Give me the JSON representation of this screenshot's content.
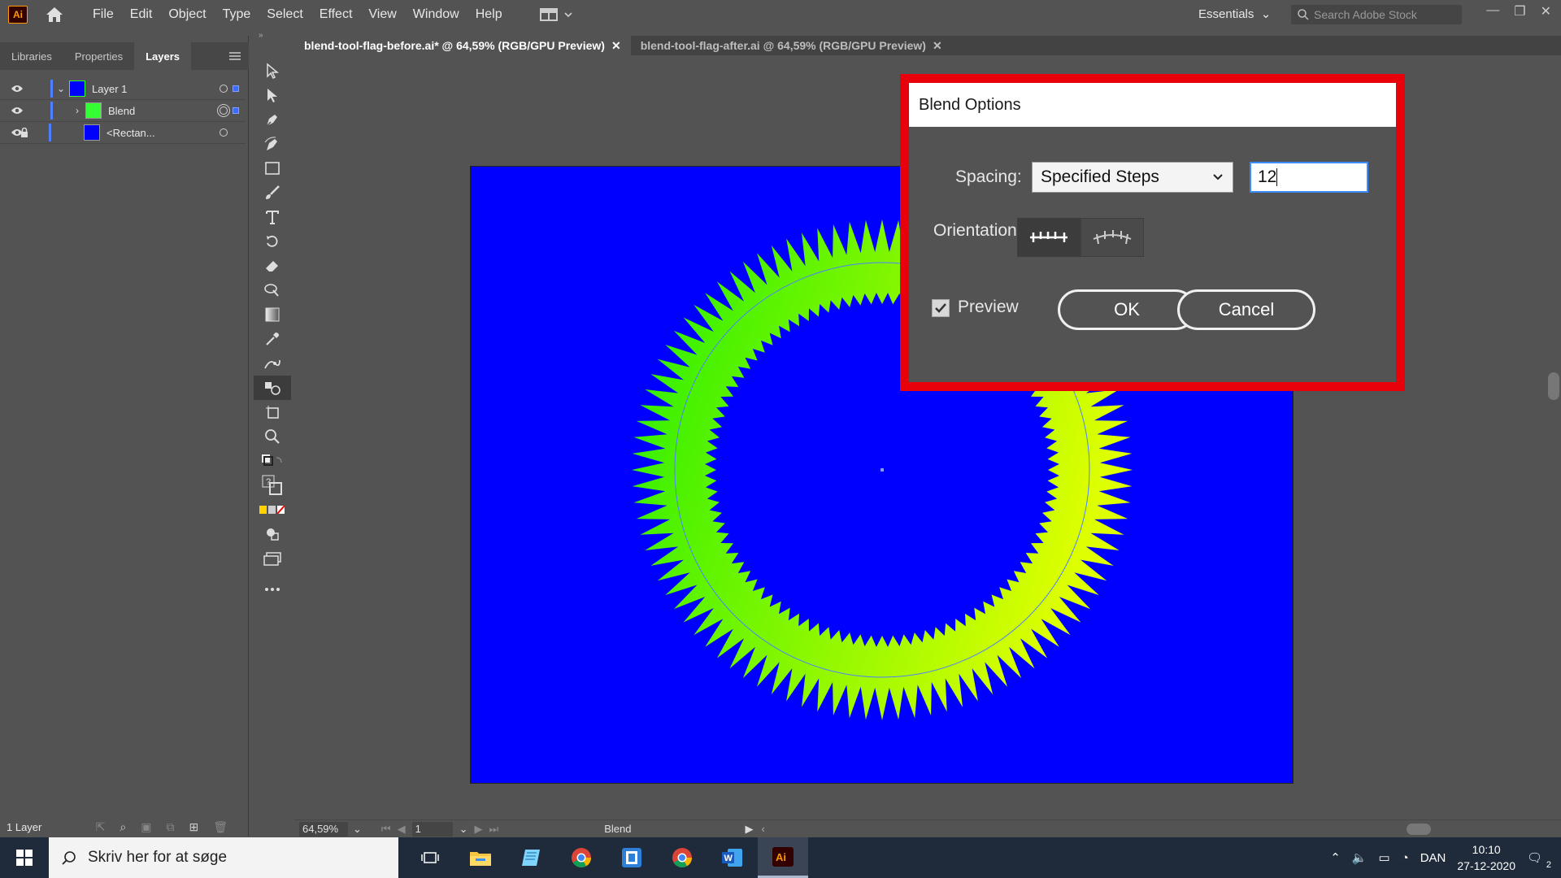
{
  "menubar": {
    "logo_text": "Ai",
    "menus": [
      "File",
      "Edit",
      "Object",
      "Type",
      "Select",
      "Effect",
      "View",
      "Window",
      "Help"
    ],
    "workspace": "Essentials",
    "stock_search_placeholder": "Search Adobe Stock"
  },
  "left_panel": {
    "tabs": [
      "Libraries",
      "Properties",
      "Layers"
    ],
    "active_tab": "Layers",
    "layers": [
      {
        "name": "Layer 1",
        "thumb_color": "#0000ff"
      },
      {
        "name": "Blend",
        "thumb_color": "#33ff33"
      },
      {
        "name": "<Rectan...",
        "thumb_color": "#0000ff"
      }
    ],
    "footer_label": "1 Layer"
  },
  "doc_tabs": [
    {
      "label": "blend-tool-flag-before.ai* @ 64,59% (RGB/GPU Preview)",
      "close": "✕"
    },
    {
      "label": "blend-tool-flag-after.ai @ 64,59% (RGB/GPU Preview)",
      "close": "✕"
    }
  ],
  "status_bar": {
    "zoom": "64,59%",
    "artboard_number": "1",
    "status_text": "Blend"
  },
  "dialog": {
    "title": "Blend Options",
    "spacing_label": "Spacing:",
    "spacing_value": "Specified Steps",
    "steps_value": "12",
    "orientation_label": "Orientation:",
    "preview_label": "Preview",
    "preview_checked": true,
    "ok_label": "OK",
    "cancel_label": "Cancel",
    "highlight_color": "#e8000b"
  },
  "artwork": {
    "background_color": "#0000ff",
    "gradient_start": "#22ee00",
    "gradient_end": "#ddff00"
  },
  "taskbar": {
    "search_placeholder": "Skriv her for at søge",
    "language": "DAN",
    "time": "10:10",
    "date": "27-12-2020",
    "notification_count": "2"
  }
}
